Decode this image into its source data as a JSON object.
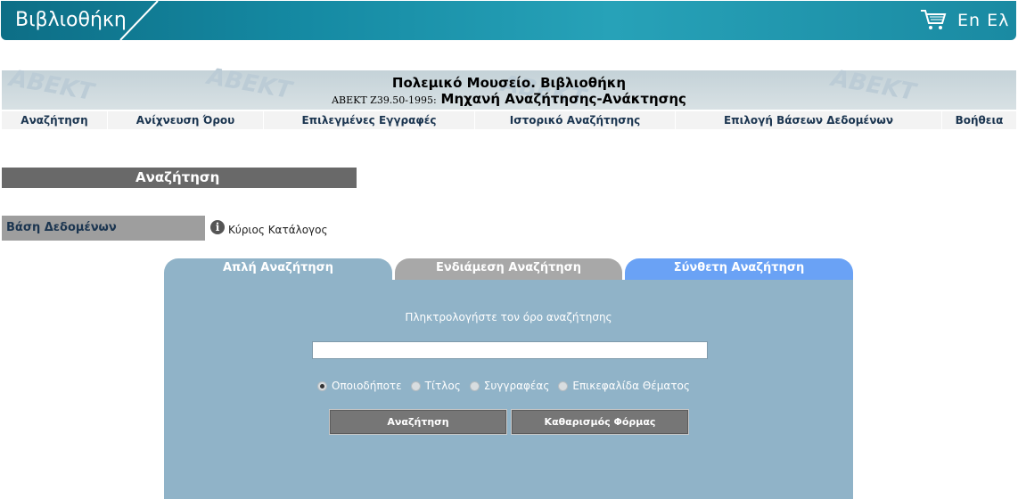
{
  "banner": {
    "title": "Βιβλιοθήκη",
    "cart_icon": "cart-icon",
    "lang": "En Ελ"
  },
  "header": {
    "line1": "Πολεμικό Μουσείο. Βιβλιοθήκη",
    "standard": "ΑΒΕΚΤ Z39.50-1995:",
    "engine": "Μηχανή Αναζήτησης-Ανάκτησης",
    "watermark": [
      "ABEKT",
      "ABEKT",
      "ABEKT",
      "ABEKT"
    ]
  },
  "nav": [
    {
      "label": "Αναζήτηση"
    },
    {
      "label": "Ανίχνευση Όρου"
    },
    {
      "label": "Επιλεγμένες Εγγραφές"
    },
    {
      "label": "Ιστορικό Αναζήτησης"
    },
    {
      "label": "Επιλογή Βάσεων Δεδομένων"
    },
    {
      "label": "Βοήθεια"
    }
  ],
  "section": {
    "title": "Αναζήτηση"
  },
  "database": {
    "label": "Βάση Δεδομένων",
    "info_icon": "info-icon",
    "value": "Κύριος Κατάλογος"
  },
  "tabs": [
    {
      "label": "Απλή Αναζήτηση"
    },
    {
      "label": "Ενδιάμεση Αναζήτηση"
    },
    {
      "label": "Σύνθετη Αναζήτηση"
    }
  ],
  "form": {
    "prompt": "Πληκτρολογήστε τον όρο αναζήτησης",
    "input_value": "",
    "radios": [
      {
        "label": "Οποιοδήποτε",
        "selected": true
      },
      {
        "label": "Τίτλος",
        "selected": false
      },
      {
        "label": "Συγγραφέας",
        "selected": false
      },
      {
        "label": "Επικεφαλίδα Θέματος",
        "selected": false
      }
    ],
    "search_button": "Αναζήτηση",
    "clear_button": "Καθαρισμός Φόρμας"
  },
  "colors": {
    "banner": "#158aa3",
    "panel": "#90b3c8",
    "tab_inactive": "#a8a8a8",
    "tab_advanced": "#6aa2f5"
  }
}
